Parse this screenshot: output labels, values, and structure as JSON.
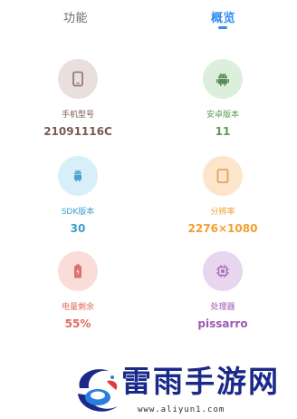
{
  "tabs": {
    "functions_label": "功能",
    "overview_label": "概览"
  },
  "cards": [
    {
      "label": "手机型号",
      "value": "21091116C",
      "icon": "phone-icon",
      "circle_color": "#e9dfdc",
      "icon_color": "#8d6f67",
      "label_color": "#7a5a52",
      "value_color": "#7a5a52"
    },
    {
      "label": "安卓版本",
      "value": "11",
      "icon": "android-icon",
      "circle_color": "#dcefdc",
      "icon_color": "#5a8e5a",
      "label_color": "#5a9a5a",
      "value_color": "#5a9a5a"
    },
    {
      "label": "SDK版本",
      "value": "30",
      "icon": "sdk-icon",
      "circle_color": "#d7eff8",
      "icon_color": "#4aa3c8",
      "label_color": "#3aa0cc",
      "value_color": "#3aa0cc"
    },
    {
      "label": "分辨率",
      "value": "2276×1080",
      "icon": "tablet-icon",
      "circle_color": "#fbe6cc",
      "icon_color": "#e79a3a",
      "label_color": "#f0a030",
      "value_color": "#f0a030"
    },
    {
      "label": "电量剩余",
      "value": "55%",
      "icon": "battery-icon",
      "circle_color": "#fadcd9",
      "icon_color": "#e0706a",
      "label_color": "#e06a5e",
      "value_color": "#e06a5e"
    },
    {
      "label": "处理器",
      "value": "pissarro",
      "icon": "processor-icon",
      "circle_color": "#e8d5ee",
      "icon_color": "#a46ab8",
      "label_color": "#9c5bb2",
      "value_color": "#9c5bb2"
    }
  ],
  "watermark": {
    "title": "雷雨手游网",
    "url": "www.aliyun1.com"
  }
}
